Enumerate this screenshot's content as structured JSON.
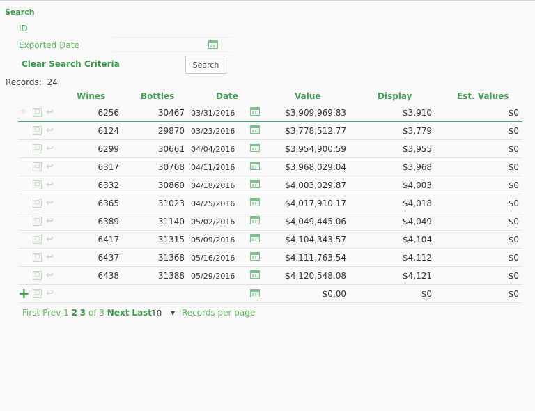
{
  "search": {
    "title": "Search",
    "id_label": "ID",
    "exported_date_label": "Exported Date",
    "clear_label": "Clear Search Criteria",
    "button_label": "Search"
  },
  "records": {
    "label": "Records:",
    "count": "24"
  },
  "columns": [
    "Wines",
    "Bottles",
    "Date",
    "Value",
    "Display",
    "Est. Values"
  ],
  "rows": [
    {
      "wines": "6256",
      "bottles": "30467",
      "date": "03/31/2016",
      "value": "$3,909,969.83",
      "display": "$3,910",
      "est": "$0"
    },
    {
      "wines": "6124",
      "bottles": "29870",
      "date": "03/23/2016",
      "value": "$3,778,512.77",
      "display": "$3,779",
      "est": "$0"
    },
    {
      "wines": "6299",
      "bottles": "30661",
      "date": "04/04/2016",
      "value": "$3,954,900.59",
      "display": "$3,955",
      "est": "$0"
    },
    {
      "wines": "6317",
      "bottles": "30768",
      "date": "04/11/2016",
      "value": "$3,968,029.04",
      "display": "$3,968",
      "est": "$0"
    },
    {
      "wines": "6332",
      "bottles": "30860",
      "date": "04/18/2016",
      "value": "$4,003,029.87",
      "display": "$4,003",
      "est": "$0"
    },
    {
      "wines": "6365",
      "bottles": "31023",
      "date": "04/25/2016",
      "value": "$4,017,910.17",
      "display": "$4,018",
      "est": "$0"
    },
    {
      "wines": "6389",
      "bottles": "31140",
      "date": "05/02/2016",
      "value": "$4,049,445.06",
      "display": "$4,049",
      "est": "$0"
    },
    {
      "wines": "6417",
      "bottles": "31315",
      "date": "05/09/2016",
      "value": "$4,104,343.57",
      "display": "$4,104",
      "est": "$0"
    },
    {
      "wines": "6437",
      "bottles": "31368",
      "date": "05/16/2016",
      "value": "$4,111,763.54",
      "display": "$4,112",
      "est": "$0"
    },
    {
      "wines": "6438",
      "bottles": "31388",
      "date": "05/29/2016",
      "value": "$4,120,548.08",
      "display": "$4,121",
      "est": "$0"
    }
  ],
  "new_row": {
    "value": "$0.00",
    "display": "$0",
    "est": "$0"
  },
  "pager": {
    "first": "First",
    "prev": "Prev",
    "page1": "1",
    "page2": "2",
    "page3": "3",
    "of": "of 3",
    "next": "Next",
    "last": "Last",
    "per_page_value": "10",
    "per_page_label": "Records per page"
  }
}
